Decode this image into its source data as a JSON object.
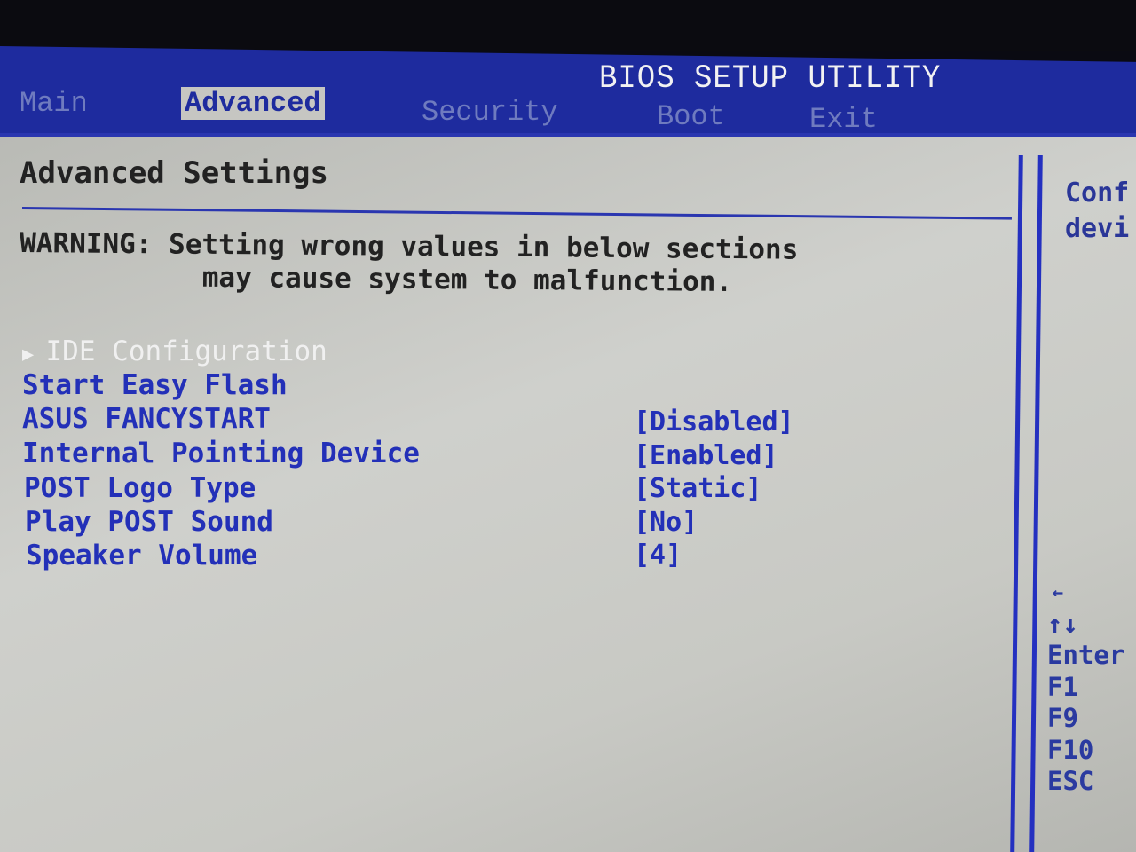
{
  "header": {
    "title": "BIOS SETUP UTILITY",
    "tabs": [
      {
        "label": "Main"
      },
      {
        "label": "Advanced",
        "active": true
      },
      {
        "label": "Security"
      },
      {
        "label": "Boot"
      },
      {
        "label": "Exit"
      }
    ]
  },
  "main": {
    "heading": "Advanced Settings",
    "warning_line1": "WARNING: Setting wrong values in below sections",
    "warning_line2": "may cause system to malfunction.",
    "items": [
      {
        "label": "IDE Configuration",
        "submenu": true,
        "selected": true
      },
      {
        "label": "Start Easy Flash"
      },
      {
        "label": "ASUS FANCYSTART",
        "value": "[Disabled]"
      },
      {
        "label": "Internal Pointing Device",
        "value": "[Enabled]"
      },
      {
        "label": "POST Logo Type",
        "value": "[Static]"
      },
      {
        "label": "Play POST Sound",
        "value": "[No]"
      },
      {
        "label": "Speaker Volume",
        "value": "[4]"
      }
    ]
  },
  "help": {
    "line1": "Conf",
    "line2": "devi"
  },
  "keys": [
    "←",
    "↑↓",
    "Enter",
    "F1",
    "F9",
    "F10",
    "ESC"
  ],
  "colors": {
    "bar": "#1e2b9e",
    "background": "#c8c9c4",
    "item_text": "#2330b8",
    "selected_text": "#f0f0f0"
  }
}
